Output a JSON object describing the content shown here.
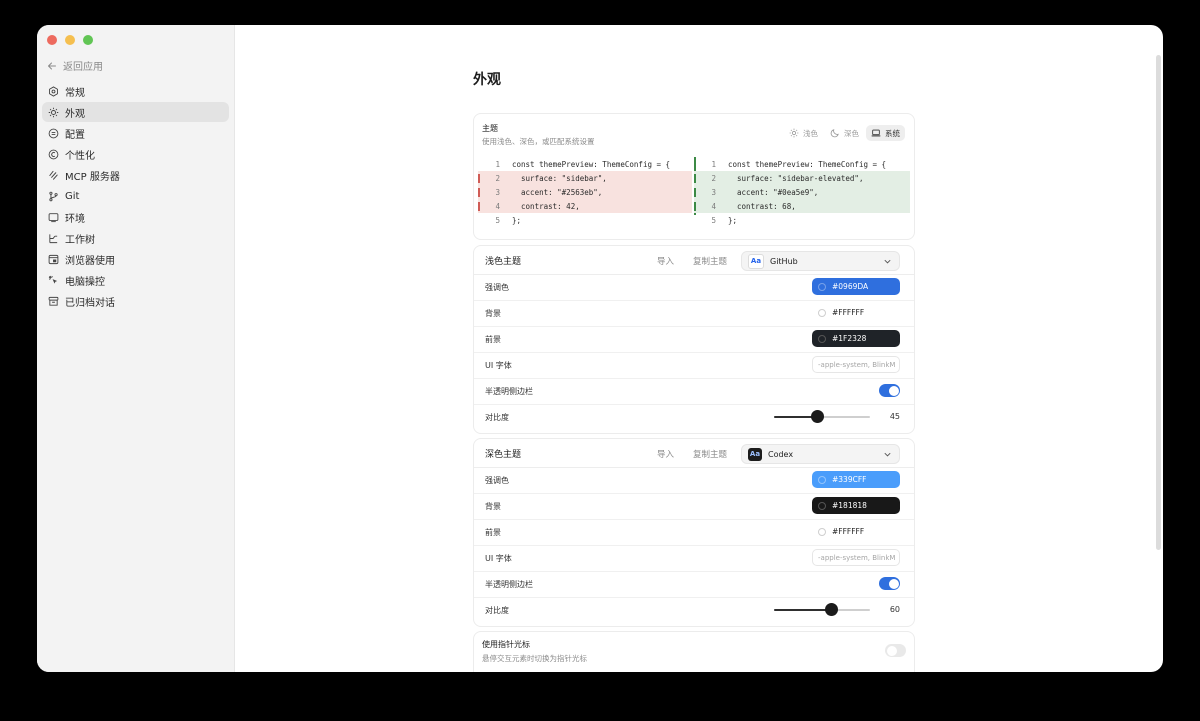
{
  "window": {
    "traffic_lights": [
      "#ed6a5e",
      "#f5bf4f",
      "#61c554"
    ]
  },
  "sidebar": {
    "back_label": "返回应用",
    "items": [
      {
        "label": "常规",
        "icon": "gear-icon",
        "active": false
      },
      {
        "label": "外观",
        "icon": "sun-icon",
        "active": true
      },
      {
        "label": "配置",
        "icon": "config-icon",
        "active": false
      },
      {
        "label": "个性化",
        "icon": "personalize-icon",
        "active": false
      },
      {
        "label": "MCP 服务器",
        "icon": "mcp-icon",
        "active": false
      },
      {
        "label": "Git",
        "icon": "git-branch-icon",
        "active": false
      },
      {
        "label": "环境",
        "icon": "monitor-icon",
        "active": false
      },
      {
        "label": "工作树",
        "icon": "worktree-icon",
        "active": false
      },
      {
        "label": "浏览器使用",
        "icon": "browser-icon",
        "active": false
      },
      {
        "label": "电脑操控",
        "icon": "cursor-icon",
        "active": false
      },
      {
        "label": "已归档对话",
        "icon": "archive-icon",
        "active": false
      }
    ]
  },
  "main": {
    "title": "外观",
    "theme": {
      "title": "主题",
      "subtitle": "使用浅色、深色，或匹配系统设置",
      "modes": [
        {
          "label": "浅色",
          "icon": "sun-icon",
          "active": false
        },
        {
          "label": "深色",
          "icon": "moon-icon",
          "active": false
        },
        {
          "label": "系统",
          "icon": "laptop-icon",
          "active": true
        }
      ],
      "diff": {
        "left": [
          {
            "n": "1",
            "code": "const themePreview: ThemeConfig = {",
            "type": "ctx"
          },
          {
            "n": "2",
            "code": "  surface: \"sidebar\",",
            "type": "del"
          },
          {
            "n": "3",
            "code": "  accent: \"#2563eb\",",
            "type": "del"
          },
          {
            "n": "4",
            "code": "  contrast: 42,",
            "type": "del"
          },
          {
            "n": "5",
            "code": "};",
            "type": "ctx"
          }
        ],
        "right": [
          {
            "n": "1",
            "code": "const themePreview: ThemeConfig = {",
            "type": "ctx"
          },
          {
            "n": "2",
            "code": "  surface: \"sidebar-elevated\",",
            "type": "add"
          },
          {
            "n": "3",
            "code": "  accent: \"#0ea5e9\",",
            "type": "add"
          },
          {
            "n": "4",
            "code": "  contrast: 68,",
            "type": "add"
          },
          {
            "n": "5",
            "code": "};",
            "type": "ctx"
          }
        ]
      }
    },
    "light_theme": {
      "title": "浅色主题",
      "import_label": "导入",
      "copy_label": "复制主题",
      "selected_theme": "GitHub",
      "accent_label": "强调色",
      "accent_value": "#0969DA",
      "accent_color": "#2f6fde",
      "background_label": "背景",
      "background_value": "#FFFFFF",
      "foreground_label": "前景",
      "foreground_value": "#1F2328",
      "ui_font_label": "UI 字体",
      "ui_font_value": "-apple-system, BlinkM",
      "translucent_label": "半透明侧边栏",
      "translucent_on": true,
      "contrast_label": "对比度",
      "contrast_value": "45"
    },
    "dark_theme": {
      "title": "深色主题",
      "import_label": "导入",
      "copy_label": "复制主题",
      "selected_theme": "Codex",
      "accent_label": "强调色",
      "accent_value": "#339CFF",
      "accent_color": "#4a9dfb",
      "background_label": "背景",
      "background_value": "#181818",
      "foreground_label": "前景",
      "foreground_value": "#FFFFFF",
      "ui_font_label": "UI 字体",
      "ui_font_value": "-apple-system, BlinkM",
      "translucent_label": "半透明侧边栏",
      "translucent_on": true,
      "contrast_label": "对比度",
      "contrast_value": "60"
    },
    "pointer_cursor": {
      "title": "使用指针光标",
      "subtitle": "悬停交互元素时切换为指针光标",
      "enabled": false
    }
  }
}
